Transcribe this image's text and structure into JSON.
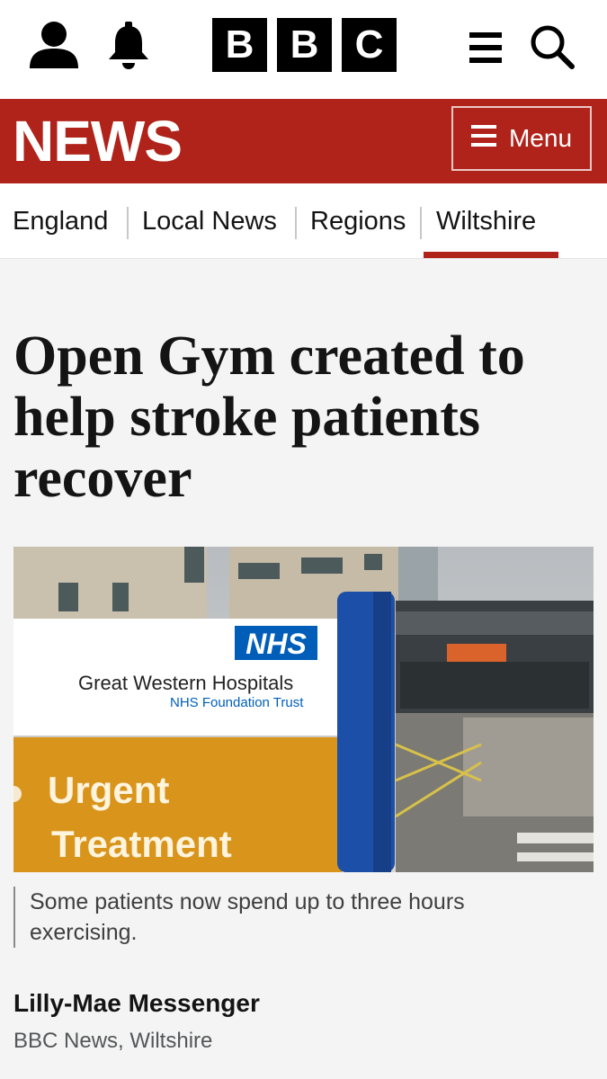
{
  "header": {
    "logo_letters": [
      "B",
      "B",
      "C"
    ],
    "icons": [
      "account-icon",
      "notifications-bell-icon",
      "hamburger-menu-icon",
      "search-icon"
    ]
  },
  "news_bar": {
    "title": "NEWS",
    "menu_label": "Menu",
    "color": "#b0231b"
  },
  "nav": {
    "items": [
      "England",
      "Local News",
      "Regions",
      "Wiltshire"
    ],
    "active_index": 3
  },
  "article": {
    "headline": "Open Gym created to help stroke patients recover",
    "image": {
      "sign_logo": "NHS",
      "sign_name": "Great Western Hospitals",
      "sign_trust": "NHS Foundation Trust",
      "sign_line1": "Urgent",
      "sign_line2": "Treatment"
    },
    "caption": "Some patients now spend up to three hours exercising.",
    "author": "Lilly-Mae Messenger",
    "affiliation": "BBC News, Wiltshire"
  }
}
